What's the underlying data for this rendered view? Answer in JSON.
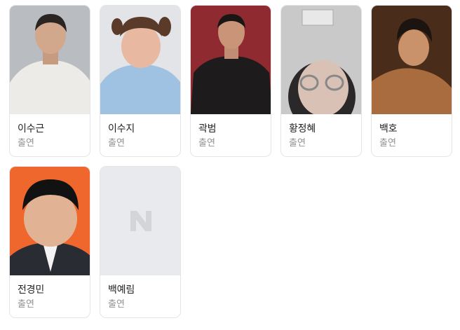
{
  "cast": [
    {
      "name": "이수근",
      "role": "출연",
      "icon": "person-photo"
    },
    {
      "name": "이수지",
      "role": "출연",
      "icon": "person-photo"
    },
    {
      "name": "곽범",
      "role": "출연",
      "icon": "person-photo"
    },
    {
      "name": "황정혜",
      "role": "출연",
      "icon": "person-photo"
    },
    {
      "name": "백호",
      "role": "출연",
      "icon": "person-photo"
    },
    {
      "name": "전경민",
      "role": "출연",
      "icon": "person-photo"
    },
    {
      "name": "백예림",
      "role": "출연",
      "icon": "placeholder-n-logo"
    }
  ]
}
